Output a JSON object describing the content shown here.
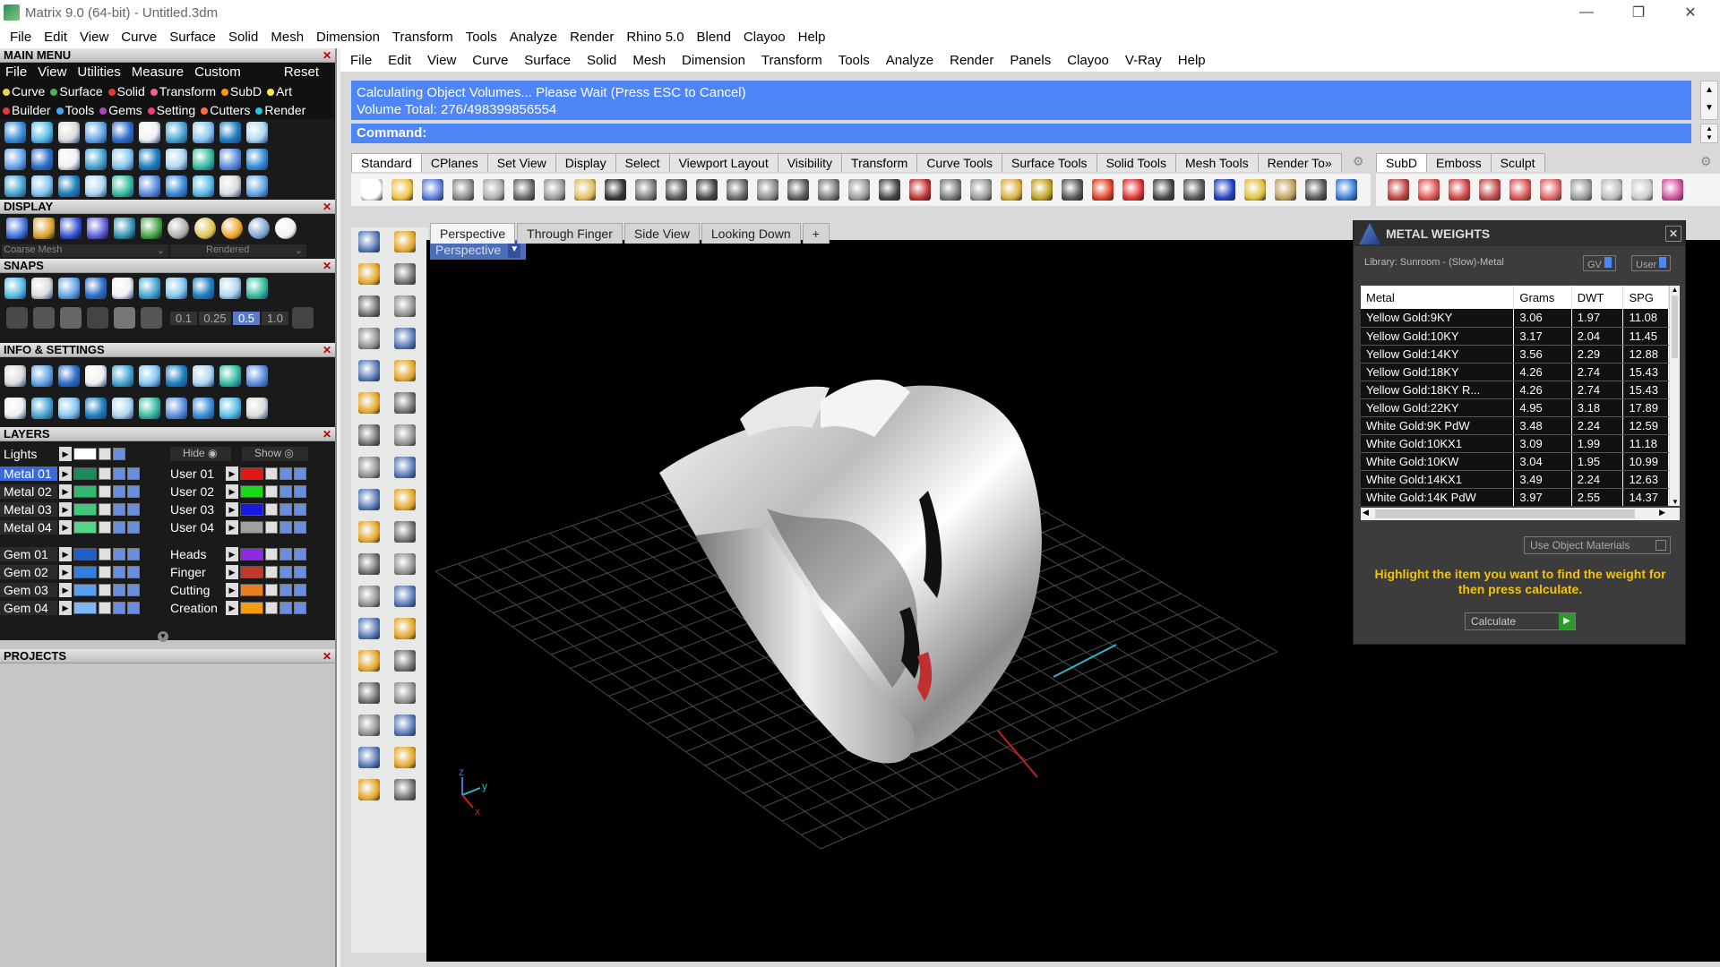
{
  "window": {
    "title": "Matrix 9.0 (64-bit) - Untitled.3dm",
    "minimize": "—",
    "restore": "❐",
    "close": "✕"
  },
  "top_menu": [
    "File",
    "Edit",
    "View",
    "Curve",
    "Surface",
    "Solid",
    "Mesh",
    "Dimension",
    "Transform",
    "Tools",
    "Analyze",
    "Render",
    "Rhino 5.0",
    "Blend",
    "Clayoo",
    "Help"
  ],
  "left": {
    "main_menu_header": "MAIN MENU",
    "main_menu_items": [
      "File",
      "View",
      "Utilities",
      "Measure",
      "Custom"
    ],
    "reset": "Reset",
    "cat_row1": [
      {
        "label": "Curve",
        "color": "#e8d44d"
      },
      {
        "label": "Surface",
        "color": "#4caf50"
      },
      {
        "label": "Solid",
        "color": "#e53935"
      },
      {
        "label": "Transform",
        "color": "#f06292"
      },
      {
        "label": "SubD",
        "color": "#ff9800"
      },
      {
        "label": "Art",
        "color": "#ffeb3b"
      }
    ],
    "cat_row2": [
      {
        "label": "Builder",
        "color": "#e53935"
      },
      {
        "label": "Tools",
        "color": "#42a5f5"
      },
      {
        "label": "Gems",
        "color": "#ab47bc"
      },
      {
        "label": "Setting",
        "color": "#ec407a"
      },
      {
        "label": "Cutters",
        "color": "#ff7043"
      },
      {
        "label": "Render",
        "color": "#26c6da"
      }
    ],
    "display_header": "DISPLAY",
    "display_mesh": "Coarse Mesh",
    "display_mode": "Rendered",
    "snaps_header": "SNAPS",
    "snap_values": [
      "0.1",
      "0.25",
      "0.5",
      "1.0"
    ],
    "info_header": "INFO & SETTINGS",
    "layers_header": "LAYERS",
    "lights": "Lights",
    "hide": "Hide",
    "show": "Show",
    "layers_left": [
      {
        "name": "Metal 01",
        "color": "#1e8a5a",
        "selected": true
      },
      {
        "name": "Metal 02",
        "color": "#2eb872",
        "selected": false
      },
      {
        "name": "Metal 03",
        "color": "#43c77a",
        "selected": false
      },
      {
        "name": "Metal 04",
        "color": "#58d48a",
        "selected": false
      },
      {
        "name": "Gem 01",
        "color": "#1f5fc6",
        "selected": false
      },
      {
        "name": "Gem 02",
        "color": "#2f7fe0",
        "selected": false
      },
      {
        "name": "Gem 03",
        "color": "#5aa0f0",
        "selected": false
      },
      {
        "name": "Gem 04",
        "color": "#7db8f5",
        "selected": false
      }
    ],
    "layers_right": [
      {
        "name": "User 01",
        "color": "#e01818"
      },
      {
        "name": "User 02",
        "color": "#18d818"
      },
      {
        "name": "User 03",
        "color": "#1818e0"
      },
      {
        "name": "User 04",
        "color": "#a0a0a0"
      },
      {
        "name": "Heads",
        "color": "#8a2be2"
      },
      {
        "name": "Finger",
        "color": "#c0392b"
      },
      {
        "name": "Cutting",
        "color": "#e67e22"
      },
      {
        "name": "Creation",
        "color": "#f39c12"
      }
    ],
    "projects_header": "PROJECTS"
  },
  "main_menu": [
    "File",
    "Edit",
    "View",
    "Curve",
    "Surface",
    "Solid",
    "Mesh",
    "Dimension",
    "Transform",
    "Tools",
    "Analyze",
    "Render",
    "Panels",
    "Clayoo",
    "V-Ray",
    "Help"
  ],
  "command": {
    "line1": "Calculating Object Volumes... Please Wait (Press ESC to Cancel)",
    "line2": "Volume Total: 276/498399856554",
    "prompt": "Command:"
  },
  "toolbar_tabs": [
    "Standard",
    "CPlanes",
    "Set View",
    "Display",
    "Select",
    "Viewport Layout",
    "Visibility",
    "Transform",
    "Curve Tools",
    "Surface Tools",
    "Solid Tools",
    "Mesh Tools",
    "Render To»"
  ],
  "toolbar_tabs2": [
    "SubD",
    "Emboss",
    "Sculpt"
  ],
  "viewport_tabs": [
    "Perspective",
    "Through Finger",
    "Side View",
    "Looking Down"
  ],
  "viewport_add": "+",
  "viewport_label": "Perspective",
  "axis": {
    "x": "x",
    "y": "y",
    "z": "z"
  },
  "metal_weights": {
    "title": "METAL WEIGHTS",
    "library": "Library: Sunroom - (Slow)-Metal",
    "gv": "GV",
    "user": "User",
    "columns": [
      "Metal",
      "Grams",
      "DWT",
      "SPG"
    ],
    "rows": [
      [
        "Yellow Gold:9KY",
        "3.06",
        "1.97",
        "11.08"
      ],
      [
        "Yellow Gold:10KY",
        "3.17",
        "2.04",
        "11.45"
      ],
      [
        "Yellow Gold:14KY",
        "3.56",
        "2.29",
        "12.88"
      ],
      [
        "Yellow Gold:18KY",
        "4.26",
        "2.74",
        "15.43"
      ],
      [
        "Yellow Gold:18KY R...",
        "4.26",
        "2.74",
        "15.43"
      ],
      [
        "Yellow Gold:22KY",
        "4.95",
        "3.18",
        "17.89"
      ],
      [
        "White Gold:9K PdW",
        "3.48",
        "2.24",
        "12.59"
      ],
      [
        "White Gold:10KX1",
        "3.09",
        "1.99",
        "11.18"
      ],
      [
        "White Gold:10KW",
        "3.04",
        "1.95",
        "10.99"
      ],
      [
        "White Gold:14KX1",
        "3.49",
        "2.24",
        "12.63"
      ],
      [
        "White Gold:14K PdW",
        "3.97",
        "2.55",
        "14.37"
      ]
    ],
    "use_materials": "Use Object Materials",
    "hint": "Highlight the item you want to find the weight for then press calculate.",
    "calculate": "Calculate"
  }
}
